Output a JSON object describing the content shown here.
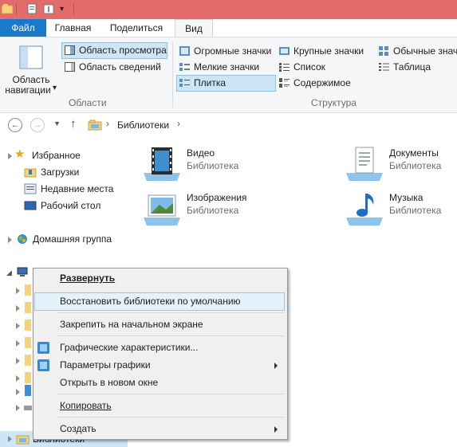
{
  "ribbon": {
    "tabs": {
      "file": "Файл",
      "home": "Главная",
      "share": "Поделиться",
      "view": "Вид"
    },
    "nav_pane": {
      "label1": "Область",
      "label2": "навигации",
      "arrow": "▾"
    },
    "panes": {
      "preview": "Область просмотра",
      "details": "Область сведений",
      "group": "Области"
    },
    "layout": {
      "extra_large": "Огромные значки",
      "large": "Крупные значки",
      "medium": "Обычные значк",
      "small": "Мелкие значки",
      "list": "Список",
      "details": "Таблица",
      "tiles": "Плитка",
      "content": "Содержимое",
      "group": "Структура"
    }
  },
  "address": {
    "path": "Библиотеки",
    "sep": "›"
  },
  "tree": {
    "favorites": "Избранное",
    "downloads": "Загрузки",
    "recent": "Недавние места",
    "desktop": "Рабочий стол",
    "homegroup": "Домашняя группа",
    "libraries": "Библиотеки"
  },
  "libraries": [
    {
      "name": "Видео",
      "type": "Библиотека"
    },
    {
      "name": "Документы",
      "type": "Библиотека"
    },
    {
      "name": "Изображения",
      "type": "Библиотека"
    },
    {
      "name": "Музыка",
      "type": "Библиотека"
    }
  ],
  "context_menu": {
    "expand": "Развернуть",
    "restore": "Восстановить библиотеки по умолчанию",
    "pin": "Закрепить на начальном экране",
    "graphics_props": "Графические характеристики...",
    "graphics_params": "Параметры графики",
    "open_new": "Открыть в новом окне",
    "copy": "Копировать",
    "create": "Создать"
  },
  "colors": {
    "title_bar": "#e36b6b",
    "file_tab": "#1979ca",
    "selection": "#cde6f7"
  }
}
